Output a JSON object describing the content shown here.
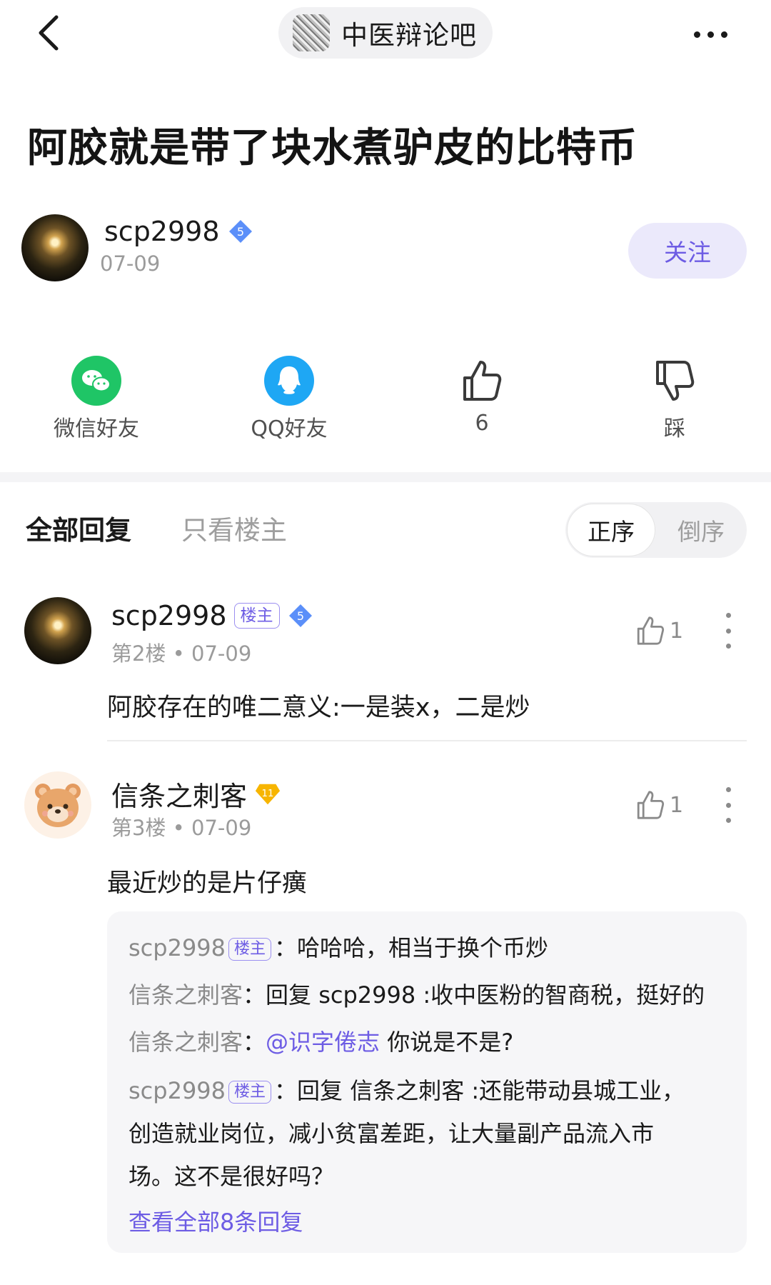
{
  "header": {
    "forum_name": "中医辩论吧",
    "back_icon": "chevron-left-icon",
    "more_icon": "more-horizontal-icon"
  },
  "post": {
    "title": "阿胶就是带了块水煮驴皮的比特币",
    "author": {
      "name": "scp2998",
      "date": "07-09",
      "level": "5"
    },
    "follow_label": "关注"
  },
  "actions": [
    {
      "icon": "wechat-icon",
      "label": "微信好友",
      "color": "#1fc566"
    },
    {
      "icon": "qq-icon",
      "label": "QQ好友",
      "color": "#1ea7f4"
    },
    {
      "icon": "thumbs-up-icon",
      "label": "6"
    },
    {
      "icon": "thumbs-down-icon",
      "label": "踩"
    }
  ],
  "tabs": {
    "all_label": "全部回复",
    "owner_only_label": "只看楼主",
    "sort_asc_label": "正序",
    "sort_desc_label": "倒序"
  },
  "replies": [
    {
      "name": "scp2998",
      "tag": "楼主",
      "level": "5",
      "floor": "第2楼",
      "date": "07-09",
      "likes": "1",
      "text": "阿胶存在的唯二意义:一是装x，二是炒"
    },
    {
      "name": "信条之刺客",
      "level": "11",
      "floor": "第3楼",
      "date": "07-09",
      "likes": "1",
      "text": "最近炒的是片仔癀",
      "sub_replies": [
        {
          "name": "scp2998",
          "tag": "楼主",
          "sep": "：",
          "text": "哈哈哈，相当于换个币炒"
        },
        {
          "name": "信条之刺客",
          "sep": "：",
          "text": "回复 scp2998 :收中医粉的智商税，挺好的"
        },
        {
          "name": "信条之刺客",
          "sep": "：",
          "mention": "@识字倦志",
          "text": " 你说是不是?"
        },
        {
          "name": "scp2998",
          "tag": "楼主",
          "sep": "：",
          "text": "回复 信条之刺客 :还能带动县城工业，",
          "text2": "创造就业岗位，减小贫富差距，让大量副产品流入市",
          "text3": "场。这不是很好吗？"
        }
      ],
      "see_all_label": "查看全部8条回复"
    }
  ],
  "colors": {
    "accent": "#6d5ce4",
    "level_blue": "#5b8ff9",
    "level_gold": "#f7b500"
  }
}
